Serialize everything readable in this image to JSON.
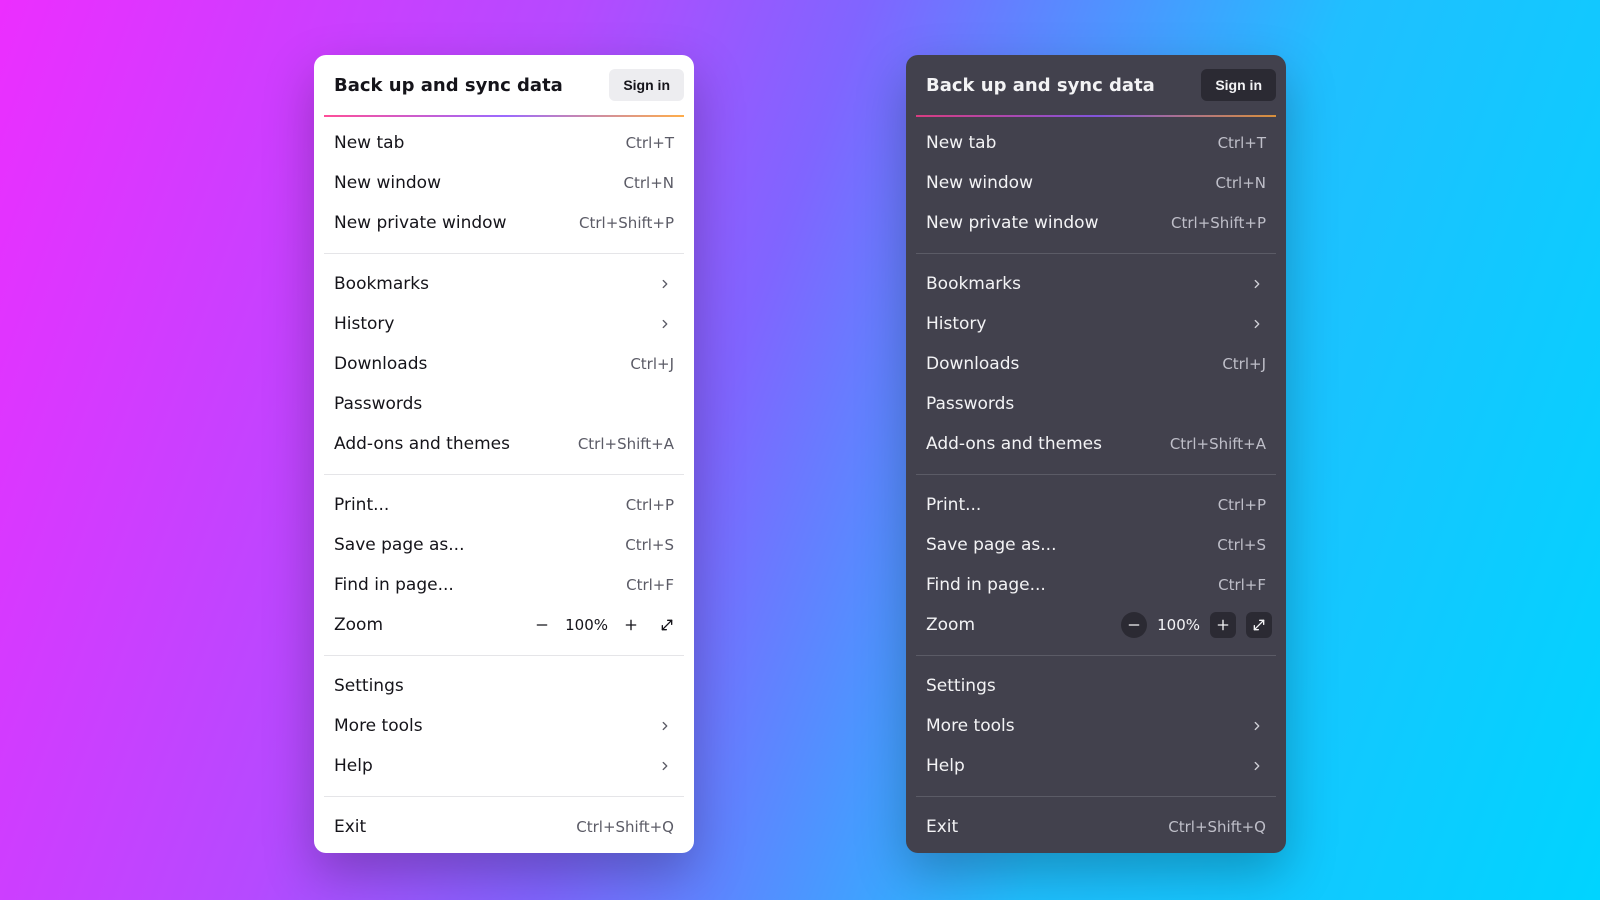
{
  "header": {
    "title": "Back up and sync data",
    "signin": "Sign in"
  },
  "zoom": {
    "label": "Zoom",
    "value": "100%"
  },
  "items": {
    "new_tab": {
      "label": "New tab",
      "shortcut": "Ctrl+T"
    },
    "new_window": {
      "label": "New window",
      "shortcut": "Ctrl+N"
    },
    "new_private": {
      "label": "New private window",
      "shortcut": "Ctrl+Shift+P"
    },
    "bookmarks": {
      "label": "Bookmarks"
    },
    "history": {
      "label": "History"
    },
    "downloads": {
      "label": "Downloads",
      "shortcut": "Ctrl+J"
    },
    "passwords": {
      "label": "Passwords"
    },
    "addons": {
      "label": "Add-ons and themes",
      "shortcut": "Ctrl+Shift+A"
    },
    "print": {
      "label": "Print...",
      "shortcut": "Ctrl+P"
    },
    "save_as": {
      "label": "Save page as...",
      "shortcut": "Ctrl+S"
    },
    "find": {
      "label": "Find in page...",
      "shortcut": "Ctrl+F"
    },
    "settings": {
      "label": "Settings"
    },
    "more_tools": {
      "label": "More tools"
    },
    "help": {
      "label": "Help"
    },
    "exit": {
      "label": "Exit",
      "shortcut": "Ctrl+Shift+Q"
    }
  }
}
